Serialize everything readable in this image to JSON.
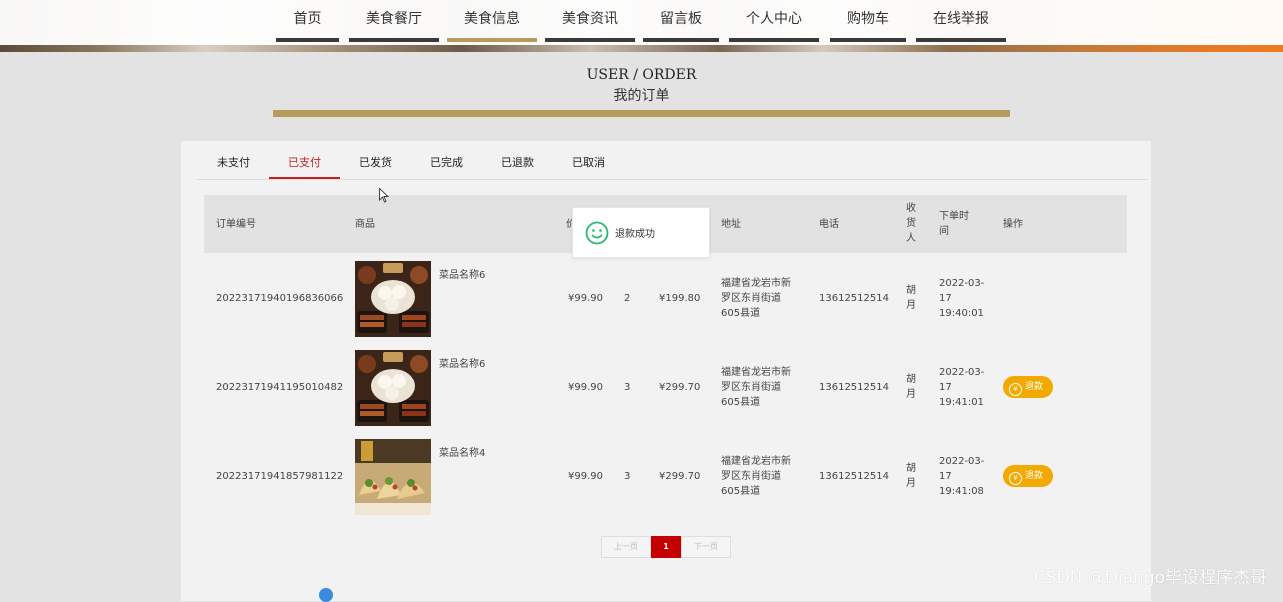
{
  "nav": [
    "首页",
    "美食餐厅",
    "美食信息",
    "美食资讯",
    "留言板",
    "个人中心",
    "购物车",
    "在线举报"
  ],
  "nav_active": "美食信息",
  "header": {
    "title_en": "USER / ORDER",
    "title_cn": "我的订单"
  },
  "tabs": [
    "未支付",
    "已支付",
    "已发货",
    "已完成",
    "已退款",
    "已取消"
  ],
  "tab_active": "已支付",
  "columns": {
    "order_no": "订单编号",
    "product": "商品",
    "price": "价",
    "address": "地址",
    "phone": "电话",
    "receiver": "收货人",
    "time": "下单时间",
    "action": "操作"
  },
  "orders": [
    {
      "order_no": "20223171940196836066",
      "name": "菜品名称6",
      "price": "¥99.90",
      "qty": "2",
      "total": "¥199.80",
      "address": "福建省龙岩市新罗区东肖街道605县道",
      "phone": "13612512514",
      "receiver": "胡月",
      "time": "2022-03-17 19:40:01",
      "action": ""
    },
    {
      "order_no": "20223171941195010482",
      "name": "菜品名称6",
      "price": "¥99.90",
      "qty": "3",
      "total": "¥299.70",
      "address": "福建省龙岩市新罗区东肖街道605县道",
      "phone": "13612512514",
      "receiver": "胡月",
      "time": "2022-03-17 19:41:01",
      "action": "退款"
    },
    {
      "order_no": "20223171941857981122",
      "name": "菜品名称4",
      "price": "¥99.90",
      "qty": "3",
      "total": "¥299.70",
      "address": "福建省龙岩市新罗区东肖街道605县道",
      "phone": "13612512514",
      "receiver": "胡月",
      "time": "2022-03-17 19:41:08",
      "action": "退款"
    }
  ],
  "pager": {
    "prev": "上一页",
    "current": "1",
    "next": "下一页"
  },
  "toast": {
    "text": "退款成功",
    "icon": "smile-icon"
  },
  "watermark": "CSDN @Django毕设程序杰哥",
  "colors": {
    "accent": "#b59b5c",
    "active_tab": "#c81e1e",
    "refund_button": "#f2a900",
    "page_current": "#c40000"
  }
}
